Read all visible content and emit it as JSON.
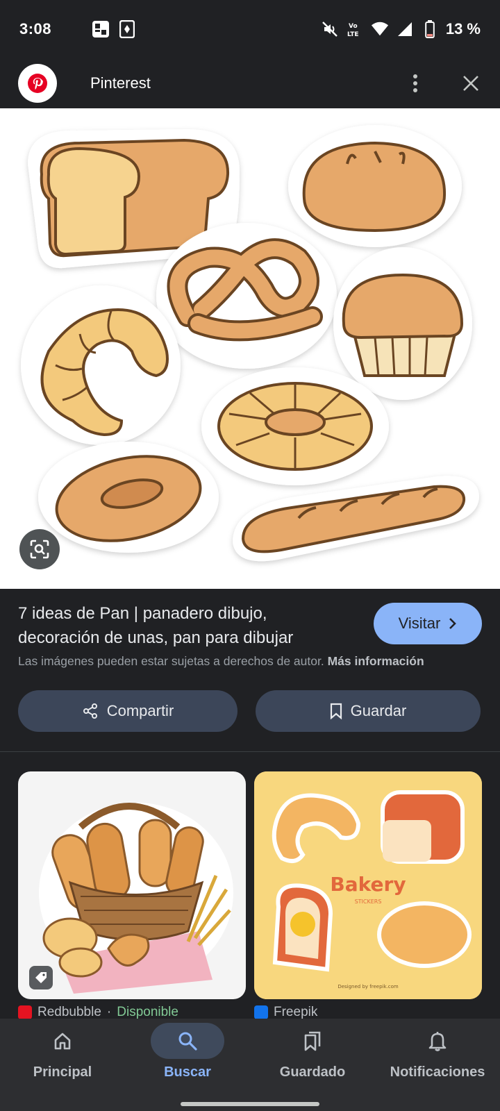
{
  "status_bar": {
    "time": "3:08",
    "battery": "13 %",
    "network": "Vo\nLTE"
  },
  "app_bar": {
    "title": "Pinterest"
  },
  "result": {
    "title": "7 ideas de Pan | panadero dibujo, decoración de unas, pan para dibujar",
    "visit_label": "Visitar",
    "copyright_text": "Las imágenes pueden estar sujetas a derechos de autor.",
    "more_info_label": "Más información",
    "share_label": "Compartir",
    "save_label": "Guardar"
  },
  "related": [
    {
      "source": "Redbubble",
      "separator": "·",
      "availability": "Disponible",
      "favicon_color": "#e41321"
    },
    {
      "source": "Freepik",
      "favicon_color": "#1273eb",
      "sticker_title": "Bakery",
      "sticker_subtitle": "STICKERS",
      "credit": "Designed by freepik.com"
    }
  ],
  "bottom_nav": {
    "items": [
      {
        "label": "Principal",
        "icon": "home-icon"
      },
      {
        "label": "Buscar",
        "icon": "search-icon",
        "active": true
      },
      {
        "label": "Guardado",
        "icon": "bookmarks-icon"
      },
      {
        "label": "Notificaciones",
        "icon": "bell-icon"
      }
    ]
  },
  "colors": {
    "accent": "#8ab4f8",
    "background": "#202124",
    "pinterest_red": "#e60023",
    "available_green": "#81c995"
  }
}
